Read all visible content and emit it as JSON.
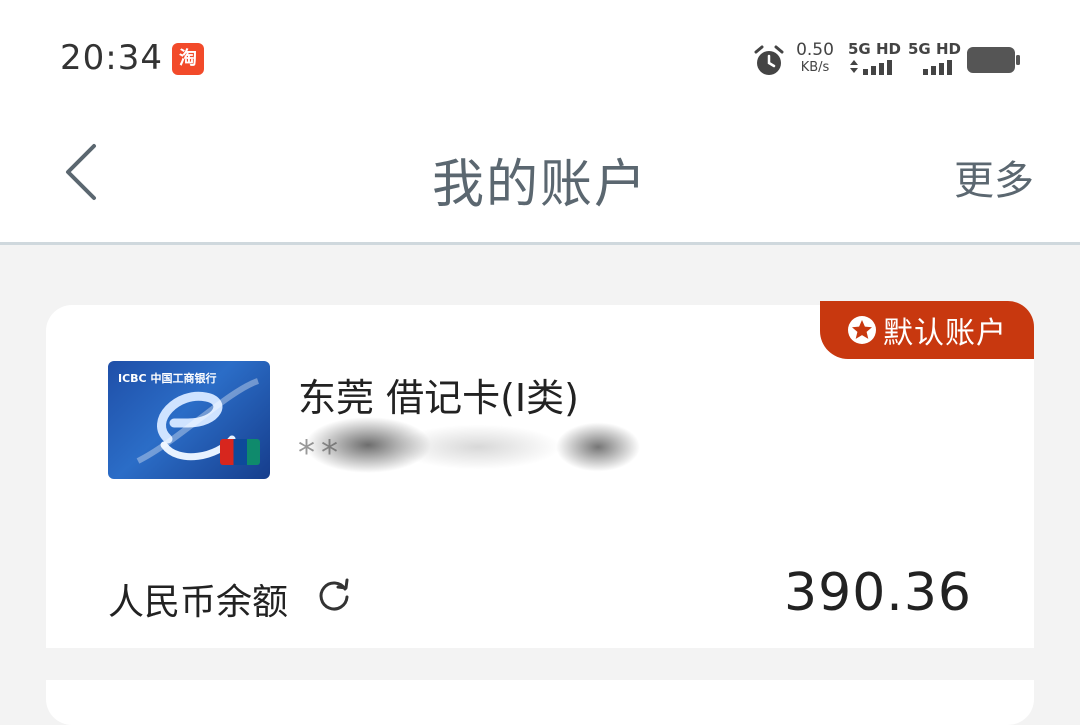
{
  "status_bar": {
    "time": "20:34",
    "app_notification_glyph": "淘",
    "net_speed_value": "0.50",
    "net_speed_unit": "KB/s",
    "sim1_label": "5G HD",
    "sim2_label": "5G HD",
    "icons": [
      "alarm-icon",
      "signal-icon",
      "battery-icon"
    ]
  },
  "nav": {
    "title": "我的账户",
    "more_label": "更多",
    "icons": [
      "back-icon"
    ]
  },
  "account_card": {
    "badge_label": "默认账户",
    "card_issuer_logo_text": "ICBC 中国工商银行",
    "card_name": "东莞 借记卡(Ⅰ类)",
    "card_number_masked": "**",
    "balance_label": "人民币余额",
    "balance_value": "390.36",
    "icons": [
      "star-icon",
      "refresh-icon"
    ]
  },
  "colors": {
    "badge_bg": "#c8380f",
    "title_text": "#5b6770",
    "page_bg": "#f3f3f3"
  }
}
